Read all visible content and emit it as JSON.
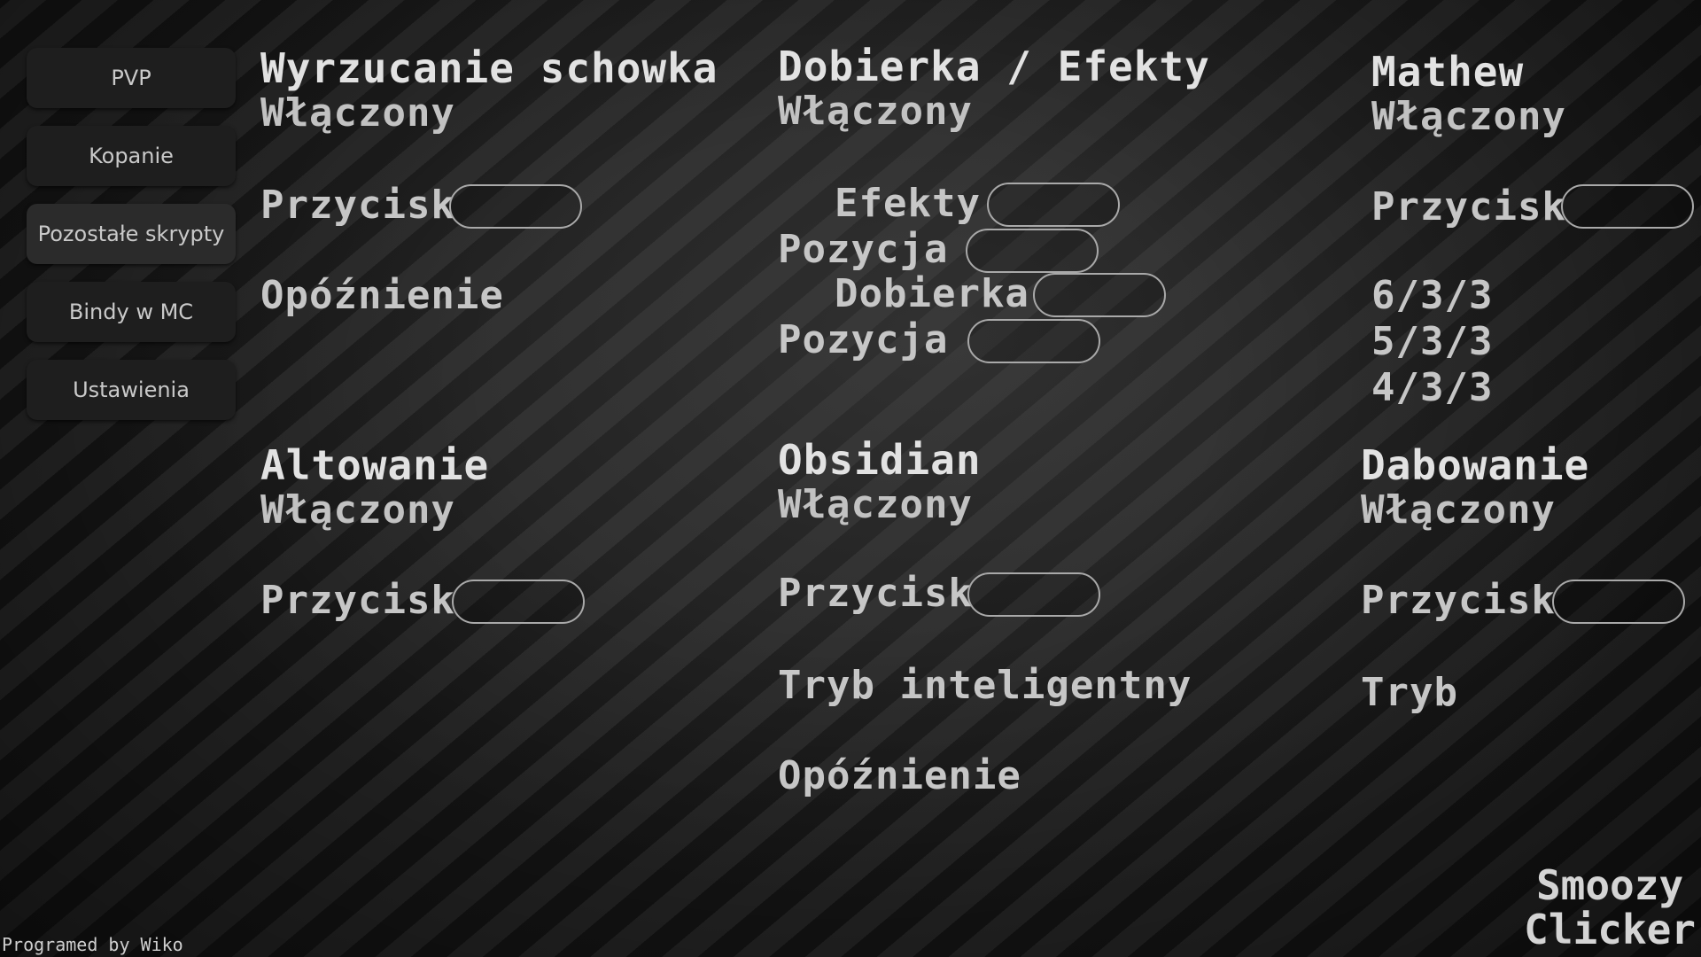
{
  "sidebar": {
    "items": [
      {
        "label": "PVP"
      },
      {
        "label": "Kopanie"
      },
      {
        "label": "Pozostałe skrypty"
      },
      {
        "label": "Bindy w MC"
      },
      {
        "label": "Ustawienia"
      }
    ]
  },
  "modules": {
    "wyrzucanie": {
      "title": "Wyrzucanie schowka",
      "status": "Włączony",
      "key_label": "Przycisk",
      "delay_label": "Opóźnienie"
    },
    "dobierka": {
      "title": "Dobierka / Efekty",
      "status": "Włączony",
      "efekty_label": "Efekty",
      "pozycja1_label": "Pozycja",
      "dobierka_label": "Dobierka",
      "pozycja2_label": "Pozycja"
    },
    "mathew": {
      "title": "Mathew",
      "status": "Włączony",
      "key_label": "Przycisk",
      "values": [
        "6/3/3",
        "5/3/3",
        "4/3/3"
      ]
    },
    "altowanie": {
      "title": "Altowanie",
      "status": "Włączony",
      "key_label": "Przycisk"
    },
    "obsidian": {
      "title": "Obsidian",
      "status": "Włączony",
      "key_label": "Przycisk",
      "smart_label": "Tryb inteligentny",
      "delay_label": "Opóźnienie"
    },
    "dabowanie": {
      "title": "Dabowanie",
      "status": "Włączony",
      "key_label": "Przycisk",
      "mode_label": "Tryb"
    }
  },
  "footer": {
    "credit": "Programed by Wiko",
    "brand_line1": "Smoozy",
    "brand_line2": "Clicker"
  }
}
